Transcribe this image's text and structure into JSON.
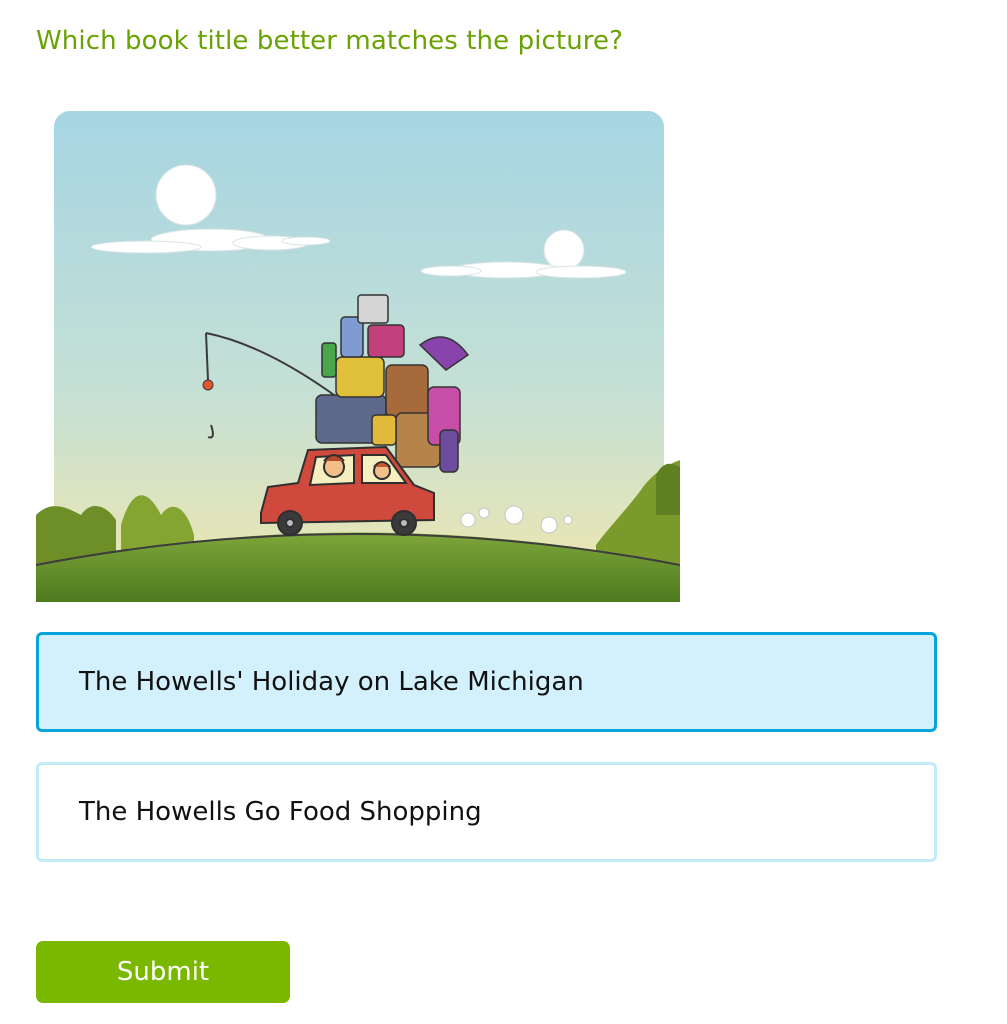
{
  "question": {
    "text": "Which book title better matches the picture?"
  },
  "picture": {
    "description_icon": "car-loaded-with-luggage-illustration"
  },
  "choices": [
    {
      "label": "The Howells' Holiday on Lake Michigan",
      "selected": true
    },
    {
      "label": "The Howells Go Food Shopping",
      "selected": false
    }
  ],
  "submit": {
    "label": "Submit"
  },
  "colors": {
    "question": "#6aa204",
    "selected_bg": "#d3f1fd",
    "selected_border": "#0aa4dc",
    "choice_border": "#c3ecfb",
    "submit_bg": "#7ab800"
  }
}
